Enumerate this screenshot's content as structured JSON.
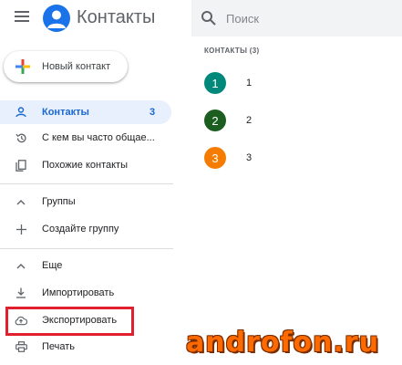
{
  "header": {
    "app_title": "Контакты",
    "menu_icon": "hamburger-menu-icon",
    "logo_icon": "contacts-logo-icon",
    "search": {
      "placeholder": "Поиск",
      "value": ""
    }
  },
  "sidebar": {
    "new_contact_label": "Новый контакт",
    "items": [
      {
        "label": "Контакты",
        "icon": "person-icon",
        "count": "3",
        "active": true
      },
      {
        "label": "С кем вы часто общае...",
        "icon": "history-icon"
      },
      {
        "label": "Похожие контакты",
        "icon": "copy-icon"
      },
      {
        "label": "Группы",
        "icon": "chevron-up-icon"
      },
      {
        "label": "Создайте группу",
        "icon": "plus-icon"
      },
      {
        "label": "Еще",
        "icon": "chevron-up-icon"
      },
      {
        "label": "Импортировать",
        "icon": "download-icon"
      },
      {
        "label": "Экспортировать",
        "icon": "cloud-upload-icon"
      },
      {
        "label": "Печать",
        "icon": "print-icon"
      }
    ]
  },
  "main": {
    "section_header": "КОНТАКТЫ (3)",
    "contacts": [
      {
        "initial": "1",
        "name": "1",
        "color": "#00897b"
      },
      {
        "initial": "2",
        "name": "2",
        "color": "#1b5e20"
      },
      {
        "initial": "3",
        "name": "3",
        "color": "#f57c00"
      }
    ]
  },
  "colors": {
    "accent": "#1a73e8",
    "active_bg": "#e8f0fe",
    "highlight": "#e0202e",
    "watermark": "#ff6a00"
  },
  "watermark": "androfon.ru"
}
